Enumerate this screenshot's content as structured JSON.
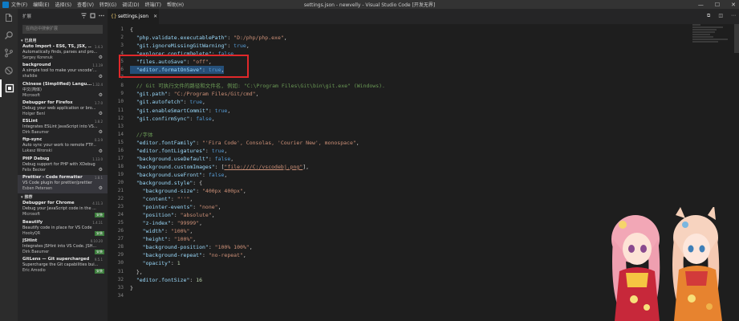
{
  "titlebar": {
    "menu": [
      "文件(F)",
      "编辑(E)",
      "选择(S)",
      "查看(V)",
      "转到(G)",
      "调试(D)",
      "终端(T)",
      "帮助(H)"
    ],
    "title": "settings.json - newvelly - Visual Studio Code [开发无界]",
    "minimize": "—",
    "maximize": "☐",
    "close": "✕"
  },
  "sidebar": {
    "header": "扩展",
    "search_placeholder": "在商店中搜索扩展",
    "installed_label": "已启用",
    "recommended_label": "推荐",
    "installed": [
      {
        "name": "Auto Import - ES6, TS, JSX, ...",
        "version": "1.4.3",
        "desc": "Automatically finds, parses and pro...",
        "author": "Sergey Korenuk"
      },
      {
        "name": "background",
        "version": "1.1.19",
        "desc": "A simple tool to make your vscode'...",
        "author": "shalldie"
      },
      {
        "name": "Chinese (Simplified) Langu...",
        "version": "1.32.4",
        "desc": "中文(简体)",
        "author": "Microsoft"
      },
      {
        "name": "Debugger for Firefox",
        "version": "1.7.0",
        "desc": "Debug your web application or bro...",
        "author": "Holger Benl"
      },
      {
        "name": "ESLint",
        "version": "1.8.2",
        "desc": "Integrates ESLint JavaScript into VS...",
        "author": "Dirk Baeumer"
      },
      {
        "name": "ftp-sync",
        "version": "0.3.9",
        "desc": "Auto sync your work to remote FTP...",
        "author": "Lukasz Wronski"
      },
      {
        "name": "PHP Debug",
        "version": "1.13.0",
        "desc": "Debug support for PHP with XDebug",
        "author": "Felix Becker"
      },
      {
        "name": "Prettier - Code formatter",
        "version": "1.8.1",
        "desc": "VS Code plugin for prettier/prettier",
        "author": "Esben Petersen"
      }
    ],
    "recommended": [
      {
        "name": "Debugger for Chrome",
        "version": "4.11.3",
        "desc": "Debug your JavaScript code in the ...",
        "author": "Microsoft",
        "badge": "安装"
      },
      {
        "name": "Beautify",
        "version": "1.4.11",
        "desc": "Beautify code in place for VS Code",
        "author": "HookyQR",
        "badge": "安装"
      },
      {
        "name": "JSHint",
        "version": "0.10.20",
        "desc": "Integrates JSHint into VS Code. JSH...",
        "author": "Dirk Baeumer",
        "badge": "安装"
      },
      {
        "name": "GitLens — Git supercharged",
        "version": "9.5.1",
        "desc": "Supercharge the Git capabilities bui...",
        "author": "Eric Amodio",
        "badge": "安装"
      }
    ]
  },
  "tab": {
    "filename": "settings.json"
  },
  "editor": {
    "lines": [
      {
        "n": "1",
        "t": [
          [
            "p",
            "{"
          ]
        ]
      },
      {
        "n": "2",
        "t": [
          [
            "p",
            "  "
          ],
          [
            "k",
            "\"php.validate.executablePath\""
          ],
          [
            "p",
            ": "
          ],
          [
            "s",
            "\"D:/php/php.exe\""
          ],
          [
            "p",
            ","
          ]
        ]
      },
      {
        "n": "3",
        "t": [
          [
            "p",
            "  "
          ],
          [
            "k",
            "\"git.ignoreMissingGitWarning\""
          ],
          [
            "p",
            ": "
          ],
          [
            "b",
            "true"
          ],
          [
            "p",
            ","
          ]
        ]
      },
      {
        "n": "4",
        "t": [
          [
            "p",
            "  "
          ],
          [
            "k",
            "\"explorer.confirmDelete\""
          ],
          [
            "p",
            ": "
          ],
          [
            "b",
            "false"
          ],
          [
            "p",
            ","
          ]
        ]
      },
      {
        "n": "5",
        "t": [
          [
            "p",
            "  "
          ],
          [
            "k",
            "\"files.autoSave\""
          ],
          [
            "p",
            ": "
          ],
          [
            "s",
            "\"off\""
          ],
          [
            "p",
            ","
          ]
        ]
      },
      {
        "n": "6",
        "hl": true,
        "t": [
          [
            "p",
            "  "
          ],
          [
            "k",
            "\"editor.formatOnSave\""
          ],
          [
            "p",
            ": "
          ],
          [
            "b",
            "true"
          ],
          [
            "p",
            ","
          ]
        ]
      },
      {
        "n": "7",
        "t": []
      },
      {
        "n": "8",
        "t": [
          [
            "p",
            "  "
          ],
          [
            "c",
            "// Git 可执行文件的路径和文件名, 例如: \"C:\\Program Files\\Git\\bin\\git.exe\" (Windows)."
          ]
        ]
      },
      {
        "n": "9",
        "t": [
          [
            "p",
            "  "
          ],
          [
            "k",
            "\"git.path\""
          ],
          [
            "p",
            ": "
          ],
          [
            "s",
            "\"C:/Program Files/Git/cmd\""
          ],
          [
            "p",
            ","
          ]
        ]
      },
      {
        "n": "10",
        "t": [
          [
            "p",
            "  "
          ],
          [
            "k",
            "\"git.autofetch\""
          ],
          [
            "p",
            ": "
          ],
          [
            "b",
            "true"
          ],
          [
            "p",
            ","
          ]
        ]
      },
      {
        "n": "11",
        "t": [
          [
            "p",
            "  "
          ],
          [
            "k",
            "\"git.enableSmartCommit\""
          ],
          [
            "p",
            ": "
          ],
          [
            "b",
            "true"
          ],
          [
            "p",
            ","
          ]
        ]
      },
      {
        "n": "12",
        "t": [
          [
            "p",
            "  "
          ],
          [
            "k",
            "\"git.confirmSync\""
          ],
          [
            "p",
            ": "
          ],
          [
            "b",
            "false"
          ],
          [
            "p",
            ","
          ]
        ]
      },
      {
        "n": "13",
        "t": []
      },
      {
        "n": "14",
        "t": [
          [
            "p",
            "  "
          ],
          [
            "c",
            "//字体"
          ]
        ]
      },
      {
        "n": "15",
        "t": [
          [
            "p",
            "  "
          ],
          [
            "k",
            "\"editor.fontFamily\""
          ],
          [
            "p",
            ": "
          ],
          [
            "s",
            "\"'Fira Code', Consolas, 'Courier New', monospace\""
          ],
          [
            "p",
            ","
          ]
        ]
      },
      {
        "n": "16",
        "t": [
          [
            "p",
            "  "
          ],
          [
            "k",
            "\"editor.fontLigatures\""
          ],
          [
            "p",
            ": "
          ],
          [
            "b",
            "true"
          ],
          [
            "p",
            ","
          ]
        ]
      },
      {
        "n": "17",
        "t": [
          [
            "p",
            "  "
          ],
          [
            "k",
            "\"background.useDefault\""
          ],
          [
            "p",
            ": "
          ],
          [
            "b",
            "false"
          ],
          [
            "p",
            ","
          ]
        ]
      },
      {
        "n": "18",
        "t": [
          [
            "p",
            "  "
          ],
          [
            "k",
            "\"background.customImages\""
          ],
          [
            "p",
            ": ["
          ],
          [
            "u",
            "\"file:///C:/vscodebj.png\""
          ],
          [
            "p",
            "],"
          ]
        ]
      },
      {
        "n": "19",
        "t": [
          [
            "p",
            "  "
          ],
          [
            "k",
            "\"background.useFront\""
          ],
          [
            "p",
            ": "
          ],
          [
            "b",
            "false"
          ],
          [
            "p",
            ","
          ]
        ]
      },
      {
        "n": "20",
        "t": [
          [
            "p",
            "  "
          ],
          [
            "k",
            "\"background.style\""
          ],
          [
            "p",
            ": {"
          ]
        ]
      },
      {
        "n": "21",
        "t": [
          [
            "p",
            "    "
          ],
          [
            "k",
            "\"background-size\""
          ],
          [
            "p",
            ": "
          ],
          [
            "s",
            "\"400px 400px\""
          ],
          [
            "p",
            ","
          ]
        ]
      },
      {
        "n": "22",
        "t": [
          [
            "p",
            "    "
          ],
          [
            "k",
            "\"content\""
          ],
          [
            "p",
            ": "
          ],
          [
            "s",
            "\"''\""
          ],
          [
            "p",
            ","
          ]
        ]
      },
      {
        "n": "23",
        "t": [
          [
            "p",
            "    "
          ],
          [
            "k",
            "\"pointer-events\""
          ],
          [
            "p",
            ": "
          ],
          [
            "s",
            "\"none\""
          ],
          [
            "p",
            ","
          ]
        ]
      },
      {
        "n": "24",
        "t": [
          [
            "p",
            "    "
          ],
          [
            "k",
            "\"position\""
          ],
          [
            "p",
            ": "
          ],
          [
            "s",
            "\"absolute\""
          ],
          [
            "p",
            ","
          ]
        ]
      },
      {
        "n": "25",
        "t": [
          [
            "p",
            "    "
          ],
          [
            "k",
            "\"z-index\""
          ],
          [
            "p",
            ": "
          ],
          [
            "s",
            "\"99999\""
          ],
          [
            "p",
            ","
          ]
        ]
      },
      {
        "n": "26",
        "t": [
          [
            "p",
            "    "
          ],
          [
            "k",
            "\"width\""
          ],
          [
            "p",
            ": "
          ],
          [
            "s",
            "\"100%\""
          ],
          [
            "p",
            ","
          ]
        ]
      },
      {
        "n": "27",
        "t": [
          [
            "p",
            "    "
          ],
          [
            "k",
            "\"height\""
          ],
          [
            "p",
            ": "
          ],
          [
            "s",
            "\"100%\""
          ],
          [
            "p",
            ","
          ]
        ]
      },
      {
        "n": "28",
        "t": [
          [
            "p",
            "    "
          ],
          [
            "k",
            "\"background-position\""
          ],
          [
            "p",
            ": "
          ],
          [
            "s",
            "\"100% 100%\""
          ],
          [
            "p",
            ","
          ]
        ]
      },
      {
        "n": "29",
        "t": [
          [
            "p",
            "    "
          ],
          [
            "k",
            "\"background-repeat\""
          ],
          [
            "p",
            ": "
          ],
          [
            "s",
            "\"no-repeat\""
          ],
          [
            "p",
            ","
          ]
        ]
      },
      {
        "n": "30",
        "t": [
          [
            "p",
            "    "
          ],
          [
            "k",
            "\"opacity\""
          ],
          [
            "p",
            ": "
          ],
          [
            "n",
            "1"
          ]
        ]
      },
      {
        "n": "31",
        "t": [
          [
            "p",
            "  },"
          ]
        ]
      },
      {
        "n": "32",
        "t": [
          [
            "p",
            "  "
          ],
          [
            "k",
            "\"editor.fontSize\""
          ],
          [
            "p",
            ": "
          ],
          [
            "n",
            "16"
          ]
        ]
      },
      {
        "n": "33",
        "t": [
          [
            "p",
            "}"
          ]
        ]
      },
      {
        "n": "34",
        "t": []
      }
    ]
  },
  "colors": {
    "highlight_box": "#e0282a",
    "selection": "#264f78",
    "install_badge": "#3b7d3b"
  }
}
